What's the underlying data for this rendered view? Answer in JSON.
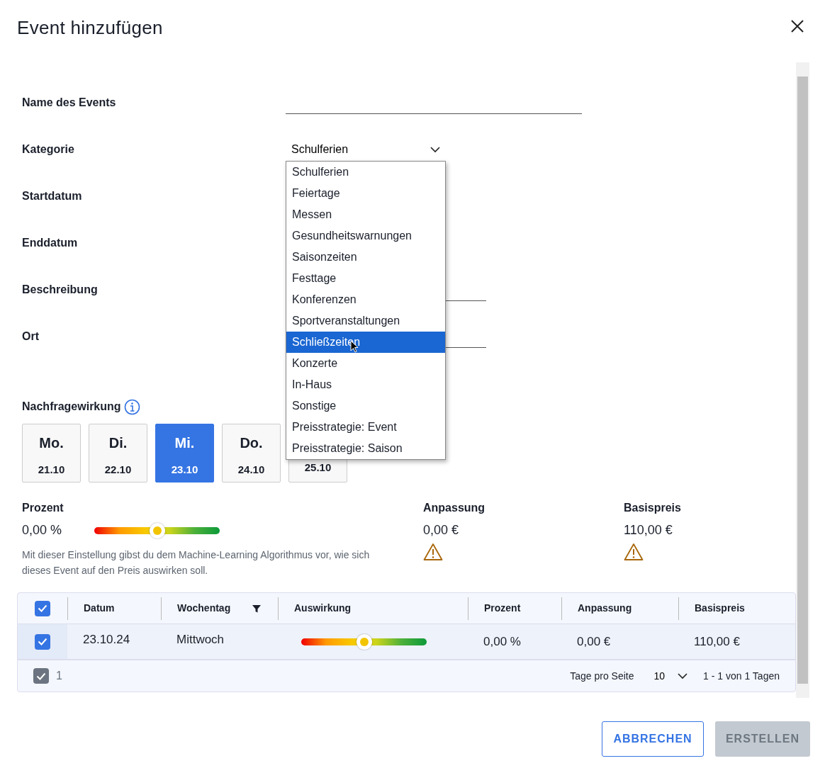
{
  "dialog": {
    "title": "Event hinzufügen"
  },
  "form": [
    {
      "label": "Name des Events",
      "kind": "text"
    },
    {
      "label": "Kategorie",
      "kind": "select",
      "value": "Schulferien",
      "expanded": true
    },
    {
      "label": "Startdatum",
      "kind": "hidden"
    },
    {
      "label": "Enddatum",
      "kind": "hidden"
    },
    {
      "label": "Beschreibung",
      "kind": "text"
    },
    {
      "label": "Ort",
      "kind": "text"
    }
  ],
  "category_options": [
    {
      "label": "Schulferien",
      "selected": false
    },
    {
      "label": "Feiertage",
      "selected": false
    },
    {
      "label": "Messen",
      "selected": false
    },
    {
      "label": "Gesundheitswarnungen",
      "selected": false
    },
    {
      "label": "Saisonzeiten",
      "selected": false
    },
    {
      "label": "Festtage",
      "selected": false
    },
    {
      "label": "Konferenzen",
      "selected": false
    },
    {
      "label": "Sportveranstaltungen",
      "selected": false
    },
    {
      "label": "Schließzeiten",
      "selected": true
    },
    {
      "label": "Konzerte",
      "selected": false
    },
    {
      "label": "In-Haus",
      "selected": false
    },
    {
      "label": "Sonstige",
      "selected": false
    },
    {
      "label": "Preisstrategie: Event",
      "selected": false
    },
    {
      "label": "Preisstrategie: Saison",
      "selected": false
    }
  ],
  "demand": {
    "title": "Nachfragewirkung",
    "days": [
      {
        "label": "Mo.",
        "date": "21.10",
        "selected": false
      },
      {
        "label": "Di.",
        "date": "22.10",
        "selected": false
      },
      {
        "label": "Mi.",
        "date": "23.10",
        "selected": true
      },
      {
        "label": "Do.",
        "date": "24.10",
        "selected": false
      },
      {
        "date": "25.10",
        "selected": false
      }
    ],
    "percent_label": "Prozent",
    "percent_value": "0,00 %",
    "level": 0.5,
    "description": "Mit dieser Einstellung gibst du dem Machine-Learning Algorithmus vor, wie sich dieses Event auf den Preis auswirken soll.",
    "adjustment_label": "Anpassung",
    "adjustment_value": "0,00 €",
    "adjustment_warning": true,
    "base_label": "Basispreis",
    "base_value": "110,00 €",
    "base_warning": true
  },
  "table": {
    "all_checked": true,
    "columns": [
      "Datum",
      "Wochentag",
      "Auswirkung",
      "Prozent",
      "Anpassung",
      "Basispreis"
    ],
    "rows": [
      {
        "checked": true,
        "date": "23.10.24",
        "weekday": "Mittwoch",
        "level": 0.5,
        "percent": "0,00 %",
        "adjustment": "0,00 €",
        "base": "110,00 €"
      }
    ],
    "footer": {
      "checked": true,
      "selected_count": "1",
      "per_page_label": "Tage pro Seite",
      "per_page": "10",
      "range": "1 - 1 von 1 Tagen"
    }
  },
  "buttons": [
    {
      "label": "ABBRECHEN",
      "disabled": false
    },
    {
      "label": "ERSTELLEN",
      "disabled": true
    }
  ]
}
